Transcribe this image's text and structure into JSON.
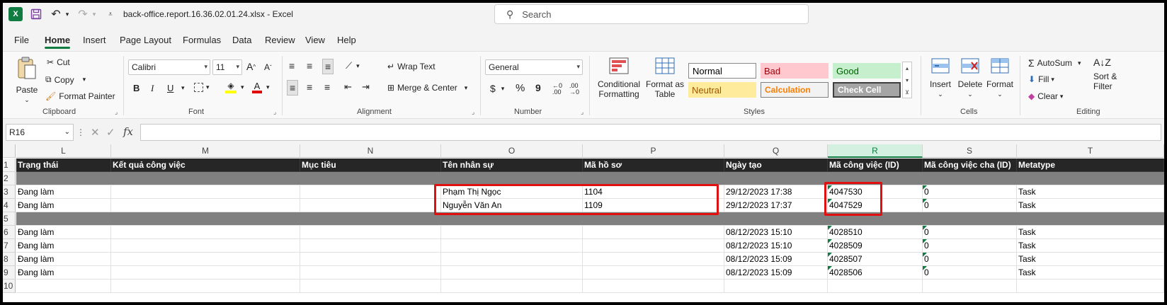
{
  "titlebar": {
    "logo": "X",
    "doc_title": "back-office.report.16.36.02.01.24.xlsx  -  Excel",
    "search_placeholder": "Search",
    "icons": [
      "excel-logo",
      "save-icon",
      "undo-icon",
      "redo-icon",
      "customize-qat-icon",
      "search-icon"
    ]
  },
  "tabs": [
    "File",
    "Home",
    "Insert",
    "Page Layout",
    "Formulas",
    "Data",
    "Review",
    "View",
    "Help"
  ],
  "active_tab": "Home",
  "ribbon": {
    "clipboard": {
      "label": "Clipboard",
      "paste": "Paste",
      "cut": "Cut",
      "copy": "Copy",
      "format_painter": "Format Painter"
    },
    "font": {
      "label": "Font",
      "font_name": "Calibri",
      "font_size": "11",
      "bold": "B",
      "italic": "I",
      "underline": "U"
    },
    "alignment": {
      "label": "Alignment",
      "wrap_text": "Wrap Text",
      "merge_center": "Merge & Center"
    },
    "number": {
      "label": "Number",
      "format": "General",
      "currency": "$",
      "percent": "%",
      "comma": "9",
      "inc_dec": "←0\n.00",
      "dec_dec": ".00\n→0"
    },
    "styles": {
      "label": "Styles",
      "conditional_formatting": "Conditional Formatting",
      "format_as_table": "Format as Table",
      "normal": "Normal",
      "bad": "Bad",
      "good": "Good",
      "neutral": "Neutral",
      "calculation": "Calculation",
      "check_cell": "Check Cell"
    },
    "cells": {
      "label": "Cells",
      "insert": "Insert",
      "delete": "Delete",
      "format": "Format"
    },
    "editing": {
      "label": "Editing",
      "autosum": "AutoSum",
      "fill": "Fill",
      "clear": "Clear",
      "sort_filter": "Sort & Filter"
    }
  },
  "formula_bar": {
    "name_box": "R16",
    "fx": "fx",
    "formula": ""
  },
  "columns": [
    {
      "letter": "L",
      "header": "Trạng thái"
    },
    {
      "letter": "M",
      "header": "Kết quả công việc"
    },
    {
      "letter": "N",
      "header": "Mục tiêu"
    },
    {
      "letter": "O",
      "header": "Tên nhân sự"
    },
    {
      "letter": "P",
      "header": "Mã hồ sơ"
    },
    {
      "letter": "Q",
      "header": "Ngày tạo"
    },
    {
      "letter": "R",
      "header": "Mã công việc (ID)"
    },
    {
      "letter": "S",
      "header": "Mã công việc cha (ID)"
    },
    {
      "letter": "T",
      "header": "Metatype"
    }
  ],
  "selected_column": "R",
  "rows": [
    {
      "num": "1",
      "type": "header"
    },
    {
      "num": "2",
      "type": "separator"
    },
    {
      "num": "3",
      "type": "data",
      "values": [
        "Đang làm",
        "",
        "",
        "Phạm Thị Ngọc",
        "1104",
        "29/12/2023 17:38",
        "4047530",
        "0",
        "Task"
      ]
    },
    {
      "num": "4",
      "type": "data",
      "values": [
        "Đang làm",
        "",
        "",
        "Nguyễn Văn An",
        "1109",
        "29/12/2023 17:37",
        "4047529",
        "0",
        "Task"
      ]
    },
    {
      "num": "5",
      "type": "separator"
    },
    {
      "num": "6",
      "type": "data",
      "values": [
        "Đang làm",
        "",
        "",
        "",
        "",
        "08/12/2023 15:10",
        "4028510",
        "0",
        "Task"
      ]
    },
    {
      "num": "7",
      "type": "data",
      "values": [
        "Đang làm",
        "",
        "",
        "",
        "",
        "08/12/2023 15:10",
        "4028509",
        "0",
        "Task"
      ]
    },
    {
      "num": "8",
      "type": "data",
      "values": [
        "Đang làm",
        "",
        "",
        "",
        "",
        "08/12/2023 15:09",
        "4028507",
        "0",
        "Task"
      ]
    },
    {
      "num": "9",
      "type": "data",
      "values": [
        "Đang làm",
        "",
        "",
        "",
        "",
        "08/12/2023 15:09",
        "4028506",
        "0",
        "Task"
      ]
    },
    {
      "num": "10",
      "type": "data",
      "values": [
        "",
        "",
        "",
        "",
        "",
        "",
        "",
        "",
        ""
      ]
    }
  ],
  "colors": {
    "accent": "#107c41",
    "header_fill": "#262626",
    "separator_fill": "#808080",
    "annotation": "#e01010"
  }
}
